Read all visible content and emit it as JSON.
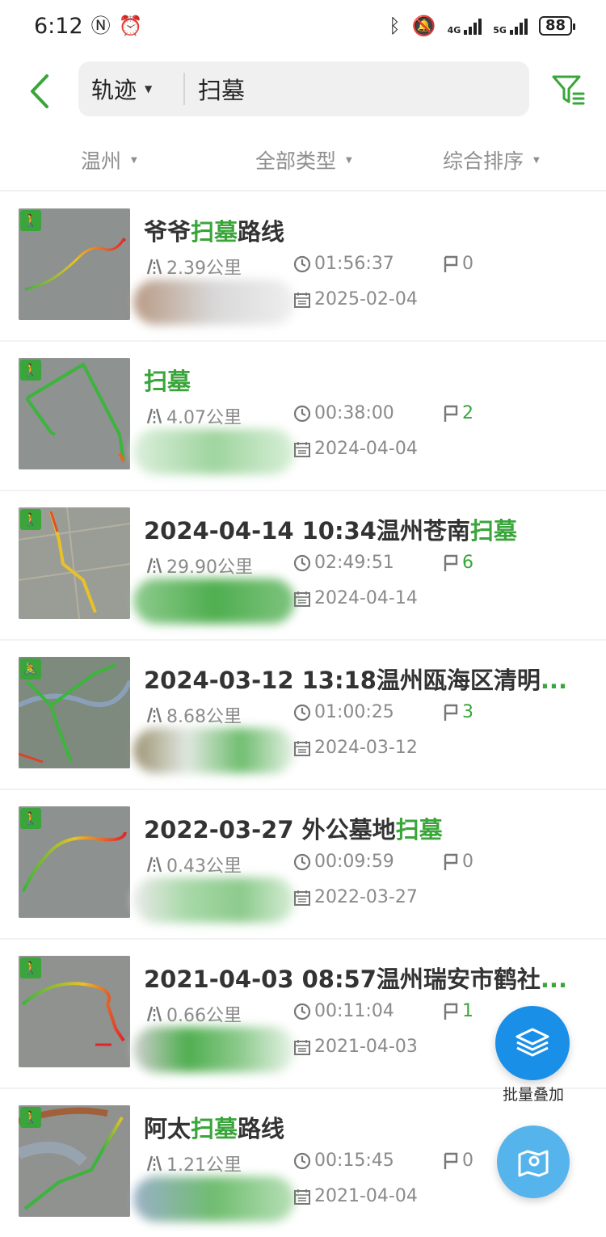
{
  "status_bar": {
    "time": "6:12",
    "battery": "88",
    "net1": "4G",
    "net2": "5G"
  },
  "search": {
    "type_label": "轨迹",
    "query": "扫墓"
  },
  "filters": [
    {
      "label": "温州"
    },
    {
      "label": "全部类型"
    },
    {
      "label": "综合排序"
    }
  ],
  "tracks": [
    {
      "title_pre": "爷爷",
      "title_hl": "扫墓",
      "title_post": "路线",
      "ellipsis": "",
      "distance": "2.39公里",
      "duration": "01:56:37",
      "points": "0",
      "date": "2025-02-04",
      "badge": "🚶"
    },
    {
      "title_pre": "",
      "title_hl": "扫墓",
      "title_post": "",
      "ellipsis": "",
      "distance": "4.07公里",
      "duration": "00:38:00",
      "points": "2",
      "date": "2024-04-04",
      "badge": "🚶"
    },
    {
      "title_pre": "2024-04-14 10:34温州苍南",
      "title_hl": "扫墓",
      "title_post": "",
      "ellipsis": "",
      "distance": "29.90公里",
      "duration": "02:49:51",
      "points": "6",
      "date": "2024-04-14",
      "badge": "🚶"
    },
    {
      "title_pre": "2024-03-12 13:18温州瓯海区清明",
      "title_hl": "",
      "title_post": "",
      "ellipsis": "...",
      "distance": "8.68公里",
      "duration": "01:00:25",
      "points": "3",
      "date": "2024-03-12",
      "badge": "🚴"
    },
    {
      "title_pre": "2022-03-27 外公墓地",
      "title_hl": "扫墓",
      "title_post": "",
      "ellipsis": "",
      "distance": "0.43公里",
      "duration": "00:09:59",
      "points": "0",
      "date": "2022-03-27",
      "badge": "🚶"
    },
    {
      "title_pre": "2021-04-03 08:57温州瑞安市鹤社",
      "title_hl": "",
      "title_post": "",
      "ellipsis": "...",
      "distance": "0.66公里",
      "duration": "00:11:04",
      "points": "1",
      "date": "2021-04-03",
      "badge": "🚶"
    },
    {
      "title_pre": "阿太",
      "title_hl": "扫墓",
      "title_post": "路线",
      "ellipsis": "",
      "distance": "1.21公里",
      "duration": "00:15:45",
      "points": "0",
      "date": "2021-04-04",
      "badge": "🚶"
    }
  ],
  "fab": {
    "batch_label": "批量叠加"
  },
  "colors": {
    "accent": "#3aa53a",
    "fab_blue": "#1a8fe8",
    "fab_light_blue": "#56b4ec",
    "muted_text": "#8a8a8a"
  },
  "icons": {
    "back": "chevron-left-icon",
    "filter": "filter-list-icon",
    "distance": "road-icon",
    "duration": "clock-icon",
    "points": "flag-icon",
    "date": "calendar-icon",
    "batch": "layers-icon",
    "map": "map-pin-icon"
  }
}
